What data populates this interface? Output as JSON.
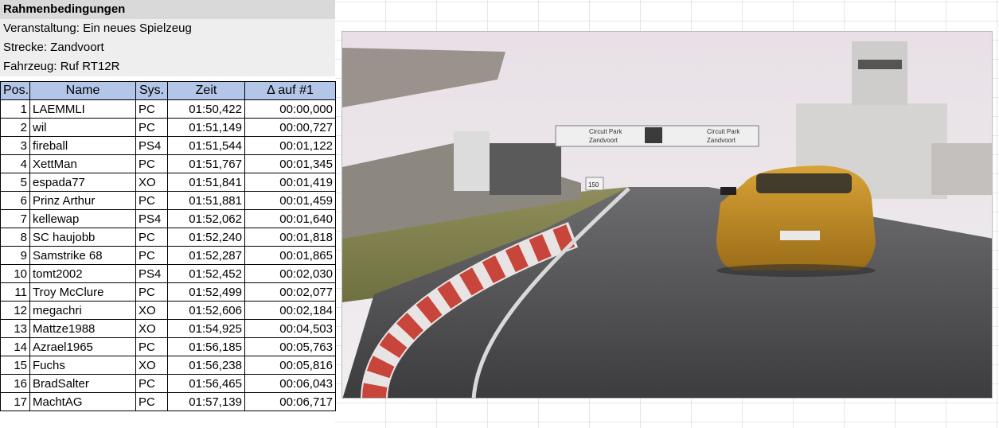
{
  "sheet": {
    "title": "Rahmenbedingungen",
    "event": "Veranstaltung: Ein neues Spielzeug",
    "track": "Strecke: Zandvoort",
    "vehicle": "Fahrzeug: Ruf RT12R"
  },
  "table": {
    "headers": [
      "Pos.",
      "Name",
      "Sys.",
      "Zeit",
      "Δ auf #1"
    ],
    "rows": [
      {
        "pos": "1",
        "name": "LAEMMLI",
        "sys": "PC",
        "time": "01:50,422",
        "delta": "00:00,000"
      },
      {
        "pos": "2",
        "name": "wil",
        "sys": "PC",
        "time": "01:51,149",
        "delta": "00:00,727"
      },
      {
        "pos": "3",
        "name": "fireball",
        "sys": "PS4",
        "time": "01:51,544",
        "delta": "00:01,122"
      },
      {
        "pos": "4",
        "name": "XettMan",
        "sys": "PC",
        "time": "01:51,767",
        "delta": "00:01,345"
      },
      {
        "pos": "5",
        "name": "espada77",
        "sys": "XO",
        "time": "01:51,841",
        "delta": "00:01,419"
      },
      {
        "pos": "6",
        "name": "Prinz Arthur",
        "sys": "PC",
        "time": "01:51,881",
        "delta": "00:01,459"
      },
      {
        "pos": "7",
        "name": "kellewap",
        "sys": "PS4",
        "time": "01:52,062",
        "delta": "00:01,640"
      },
      {
        "pos": "8",
        "name": "SC haujobb",
        "sys": "PC",
        "time": "01:52,240",
        "delta": "00:01,818"
      },
      {
        "pos": "9",
        "name": "Samstrike 68",
        "sys": "PC",
        "time": "01:52,287",
        "delta": "00:01,865"
      },
      {
        "pos": "10",
        "name": "tomt2002",
        "sys": "PS4",
        "time": "01:52,452",
        "delta": "00:02,030"
      },
      {
        "pos": "11",
        "name": "Troy McClure",
        "sys": "PC",
        "time": "01:52,499",
        "delta": "00:02,077"
      },
      {
        "pos": "12",
        "name": "megachri",
        "sys": "XO",
        "time": "01:52,606",
        "delta": "00:02,184"
      },
      {
        "pos": "13",
        "name": "Mattze1988",
        "sys": "XO",
        "time": "01:54,925",
        "delta": "00:04,503"
      },
      {
        "pos": "14",
        "name": "Azrael1965",
        "sys": "PC",
        "time": "01:56,185",
        "delta": "00:05,763"
      },
      {
        "pos": "15",
        "name": "Fuchs",
        "sys": "XO",
        "time": "01:56,238",
        "delta": "00:05,816"
      },
      {
        "pos": "16",
        "name": "BradSalter",
        "sys": "PC",
        "time": "01:56,465",
        "delta": "00:06,043"
      },
      {
        "pos": "17",
        "name": "MachtAG",
        "sys": "PC",
        "time": "01:57,139",
        "delta": "00:06,717"
      }
    ]
  },
  "photo": {
    "banner_line1": "Circuit Park",
    "banner_line2": "Zandvoort",
    "distance_sign": "150",
    "colors": {
      "sky": "#e9e2e6",
      "car": "#c7901f",
      "track": "#555555",
      "kerb_red": "#c8453c"
    }
  }
}
